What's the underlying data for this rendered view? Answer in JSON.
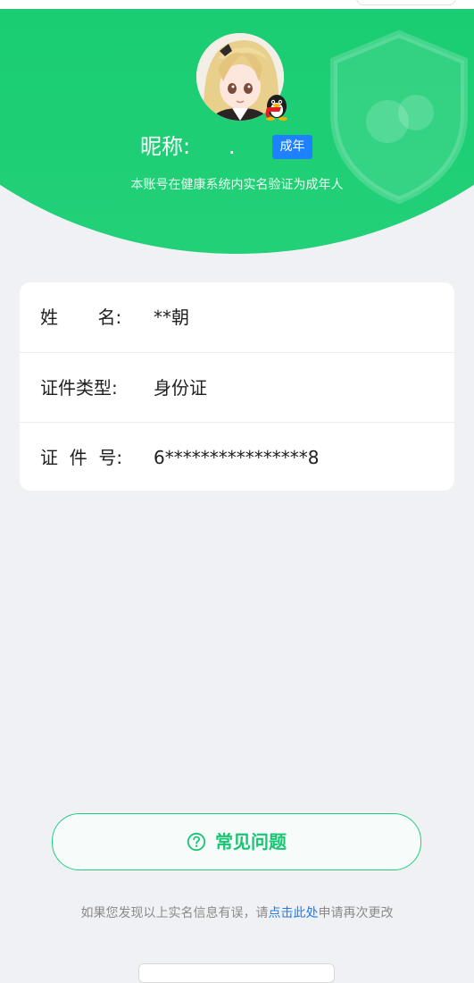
{
  "profile": {
    "nickname_label": "昵称:",
    "nickname_value": ".",
    "adult_badge": "成年",
    "verify_note": "本账号在健康系统内实名验证为成年人"
  },
  "identity": {
    "rows": [
      {
        "label": "姓       名:",
        "value": "**朝"
      },
      {
        "label": "证件类型:",
        "value": "身份证"
      },
      {
        "label": "证  件  号:",
        "value": "6****************8"
      }
    ]
  },
  "faq": {
    "label": "常见问题",
    "icon": "question-circle-icon"
  },
  "footer": {
    "note_prefix": "如果您发现以上实名信息有误，请",
    "note_link": "点击此处",
    "note_suffix": "申请再次更改"
  },
  "colors": {
    "primary_green": "#0cc778",
    "badge_blue": "#1e81ff",
    "link_blue": "#1f7cf2",
    "background": "#f0f1f5"
  }
}
